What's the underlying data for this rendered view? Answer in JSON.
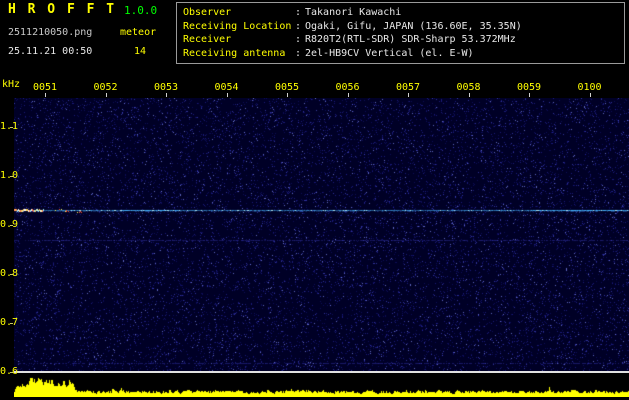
{
  "header": {
    "title": "H R O F F T",
    "version": "1.0.0",
    "filename": "2511210050.png",
    "mode_label": "meteor",
    "datetime": "25.11.21 00:50",
    "echo_count": "14",
    "separator": ":",
    "info_rows": [
      {
        "label": "Observer",
        "value": "Takanori Kawachi"
      },
      {
        "label": "Receiving Location",
        "value": "Ogaki, Gifu, JAPAN (136.60E, 35.35N)"
      },
      {
        "label": "Receiver",
        "value": "R820T2(RTL-SDR) SDR-Sharp 53.372MHz"
      },
      {
        "label": "Receiving antenna",
        "value": "2el-HB9CV Vertical (el. E-W)"
      }
    ]
  },
  "chart_data": {
    "type": "heatmap",
    "subtype": "radio-meteor-spectrogram",
    "x_tick_labels": [
      "0051",
      "0052",
      "0053",
      "0054",
      "0055",
      "0056",
      "0057",
      "0058",
      "0059",
      "0100"
    ],
    "y_axis_unit": "kHz",
    "y_tick_labels": [
      "1.1",
      "1.0",
      "0.9",
      "0.8",
      "0.7",
      "0.6"
    ],
    "y_range_khz": [
      0.58,
      1.16
    ],
    "carrier_line_khz": 0.93,
    "faint_line_khz": 0.87,
    "baseline_khz": 0.6,
    "meteor_echo_at_start": true,
    "legend": "bottom strip shows signal level bars over time, elevated near 0051",
    "colors": {
      "background": "#000000",
      "noise_floor": "#000026",
      "speckle": "#3a3ac8",
      "carrier": "#46aaff",
      "baseline_line": "#e0e0e0",
      "level_bars": "#ffff00",
      "axis_text": "#ffff00",
      "value_text": "#e8e8e8",
      "title_text": "#ffff00",
      "version_text": "#00ff00"
    }
  }
}
